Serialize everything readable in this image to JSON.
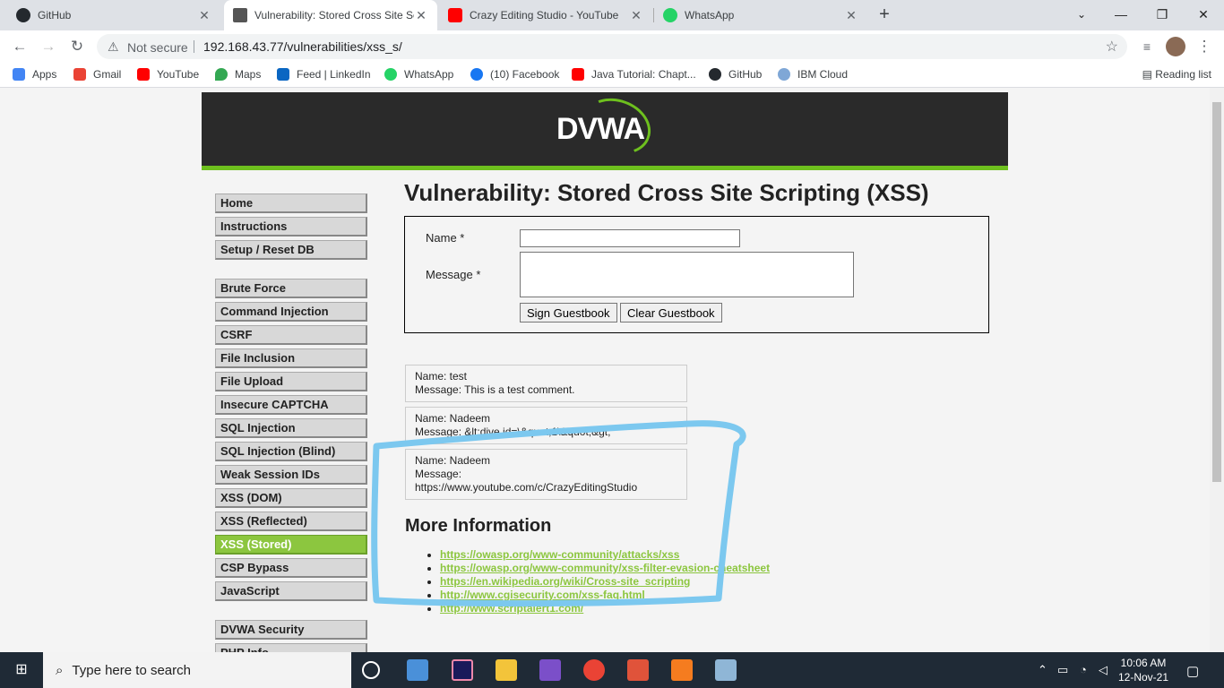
{
  "tabs": [
    {
      "label": "GitHub",
      "icon": "github-icon",
      "color": "#24292e"
    },
    {
      "label": "Vulnerability: Stored Cross Site Sc",
      "icon": "dvwa-page-icon",
      "color": "#555"
    },
    {
      "label": "Crazy Editing Studio - YouTube",
      "icon": "youtube-icon",
      "color": "#ff0000"
    },
    {
      "label": "WhatsApp",
      "icon": "whatsapp-icon",
      "color": "#25d366"
    }
  ],
  "toolbar": {
    "security": "Not secure",
    "url": "192.168.43.77/vulnerabilities/xss_s/"
  },
  "bookmarks": [
    {
      "label": "Apps",
      "color": "#4285f4"
    },
    {
      "label": "Gmail",
      "color": "#ea4335"
    },
    {
      "label": "YouTube",
      "color": "#ff0000"
    },
    {
      "label": "Maps",
      "color": "#34a853"
    },
    {
      "label": "Feed | LinkedIn",
      "color": "#0a66c2"
    },
    {
      "label": "WhatsApp",
      "color": "#25d366"
    },
    {
      "label": "(10) Facebook",
      "color": "#1877f2"
    },
    {
      "label": "Java Tutorial: Chapt...",
      "color": "#ff0000"
    },
    {
      "label": "GitHub",
      "color": "#24292e"
    },
    {
      "label": "IBM Cloud",
      "color": "#7fa7d6"
    }
  ],
  "reading_list": "Reading list",
  "logo": "DVWA",
  "menu": {
    "group1": [
      "Home",
      "Instructions",
      "Setup / Reset DB"
    ],
    "group2": [
      "Brute Force",
      "Command Injection",
      "CSRF",
      "File Inclusion",
      "File Upload",
      "Insecure CAPTCHA",
      "SQL Injection",
      "SQL Injection (Blind)",
      "Weak Session IDs",
      "XSS (DOM)",
      "XSS (Reflected)",
      "XSS (Stored)",
      "CSP Bypass",
      "JavaScript"
    ],
    "group3": [
      "DVWA Security",
      "PHP Info"
    ],
    "selected": "XSS (Stored)"
  },
  "page": {
    "title": "Vulnerability: Stored Cross Site Scripting (XSS)",
    "name_label": "Name *",
    "message_label": "Message *",
    "sign_button": "Sign Guestbook",
    "clear_button": "Clear Guestbook",
    "more_info": "More Information"
  },
  "entries": [
    {
      "name": "Name: test",
      "message": "Message: This is a test comment."
    },
    {
      "name": "Name: Nadeem",
      "message": "Message: &lt;dive id=\\&quot;1\\&quot;&gt;"
    },
    {
      "name": "Name: Nadeem",
      "message": "Message:",
      "message2": "https://www.youtube.com/c/CrazyEditingStudio"
    }
  ],
  "links": [
    "https://owasp.org/www-community/attacks/xss",
    "https://owasp.org/www-community/xss-filter-evasion-cheatsheet",
    "https://en.wikipedia.org/wiki/Cross-site_scripting",
    "http://www.cgisecurity.com/xss-faq.html",
    "http://www.scriptalert1.com/"
  ],
  "taskbar": {
    "search_placeholder": "Type here to search",
    "time": "10:06 AM",
    "date": "12-Nov-21"
  },
  "colors": {
    "accent": "#8cc63f",
    "highlight": "#7cc8ef"
  }
}
